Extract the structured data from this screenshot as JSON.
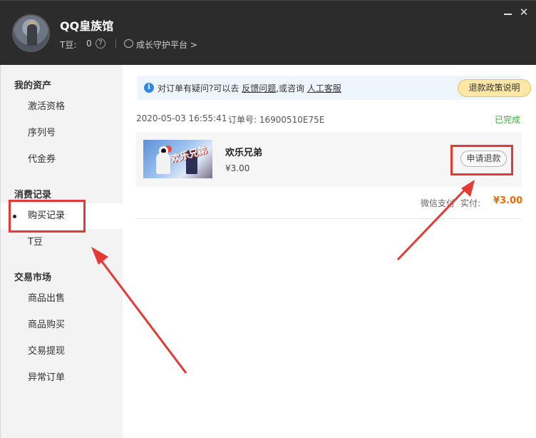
{
  "header": {
    "title": "QQ皇族馆",
    "tdou_label": "T豆:",
    "tdou_value": "0",
    "help_glyph": "?",
    "guard_link": "成长守护平台 >",
    "close_glyph": "✕"
  },
  "sidebar": {
    "sections": [
      {
        "title": "我的资产",
        "items": [
          "激活资格",
          "序列号",
          "代金券"
        ]
      },
      {
        "title": "消费记录",
        "items": [
          "购买记录",
          "T豆"
        ]
      },
      {
        "title": "交易市场",
        "items": [
          "商品出售",
          "商品购买",
          "交易提现",
          "异常订单"
        ]
      }
    ],
    "active_item": "购买记录"
  },
  "notice": {
    "icon_glyph": "i",
    "text_before": "对订单有疑问?可以去",
    "link_feedback": "反馈问题",
    "text_middle": ",或咨询",
    "link_service": "人工客服",
    "policy_button": "退款政策说明"
  },
  "order": {
    "date": "2020-05-03 16:55:41",
    "number": "订单号: 16900510E75E",
    "status": "已完成",
    "item_name": "欢乐兄弟",
    "item_price": "¥3.00",
    "refund_button": "申请退款",
    "pay_method": "微信支付",
    "pay_label": "实付:",
    "pay_amount": "¥3.00",
    "thumb_logo": "欢乐兄弟"
  },
  "colors": {
    "header_bg": "#2c2c2c",
    "status_green": "#3aaa35",
    "amount_orange": "#f06a00",
    "annotation_red": "#e53935",
    "info_blue": "#2f8ae5"
  }
}
